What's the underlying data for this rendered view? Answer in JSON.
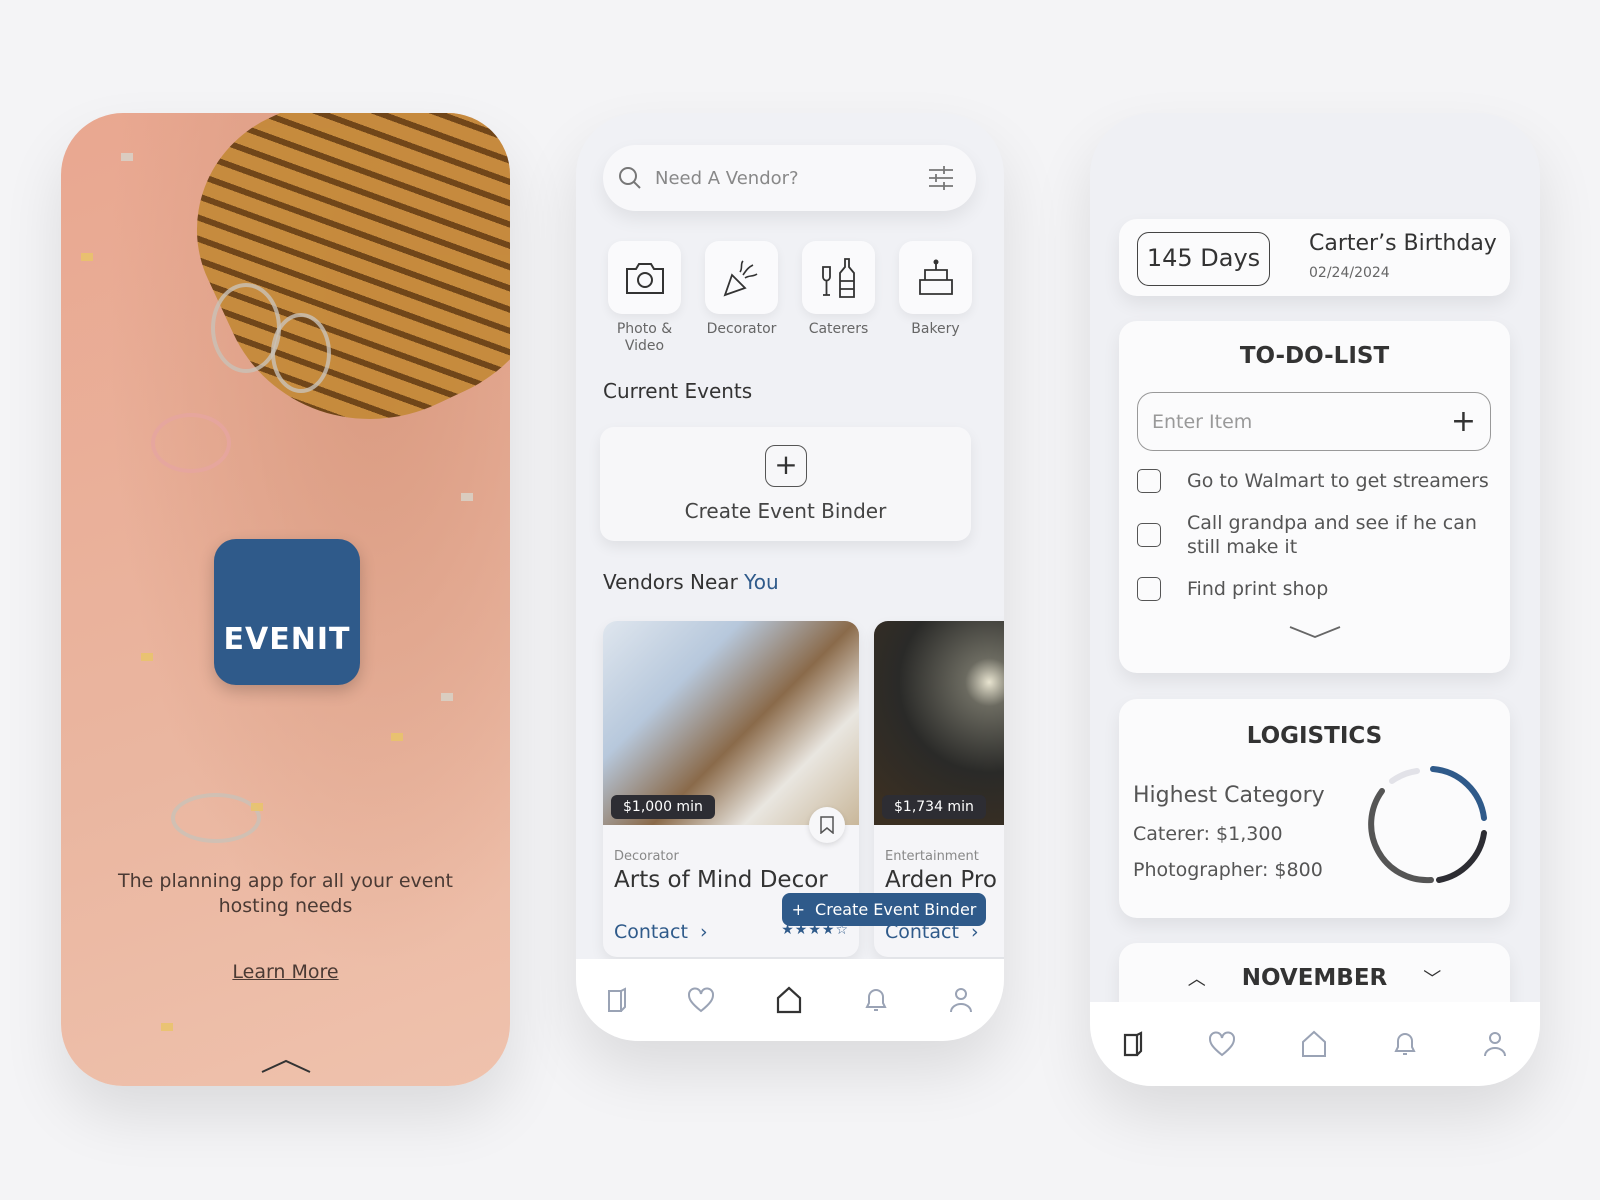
{
  "splash": {
    "logo_text": "EVENIT",
    "tagline": "The planning app for all your event hosting needs",
    "learn_more": "Learn More"
  },
  "home": {
    "search_placeholder": "Need A Vendor?",
    "categories": [
      {
        "label": "Photo & Video",
        "icon": "camera-icon"
      },
      {
        "label": "Decorator",
        "icon": "party-popper-icon"
      },
      {
        "label": "Caterers",
        "icon": "wine-bottle-icon"
      },
      {
        "label": "Bakery",
        "icon": "cake-icon"
      }
    ],
    "current_events_title": "Current Events",
    "create_binder_label": "Create Event Binder",
    "vendors_title_a": "Vendors Near",
    "vendors_title_b": "You",
    "vendors": [
      {
        "price": "$1,000 min",
        "category": "Decorator",
        "name": "Arts of Mind Decor",
        "contact": "Contact",
        "rating": 4,
        "stars": "★★★★☆"
      },
      {
        "price": "$1,734 min",
        "category": "Entertainment",
        "name": "Arden Pro",
        "contact": "Contact"
      }
    ],
    "fab_label": "Create Event Binder",
    "active_nav": "home"
  },
  "dashboard": {
    "countdown": "145 Days",
    "event_name": "Carter’s Birthday",
    "event_date": "02/24/2024",
    "todo_title": "TO-DO-LIST",
    "todo_placeholder": "Enter Item",
    "todo_items": [
      "Go to Walmart to get streamers",
      "Call grandpa and see if he can still make it",
      "Find print shop"
    ],
    "logistics_title": "LOGISTICS",
    "highest_category": "Highest Category",
    "line1": "Caterer: $1,300",
    "line2": "Photographer: $800",
    "month": "NOVEMBER",
    "active_nav": "binder"
  },
  "colors": {
    "accent": "#2f5a8a",
    "dark": "#2d2d33"
  }
}
